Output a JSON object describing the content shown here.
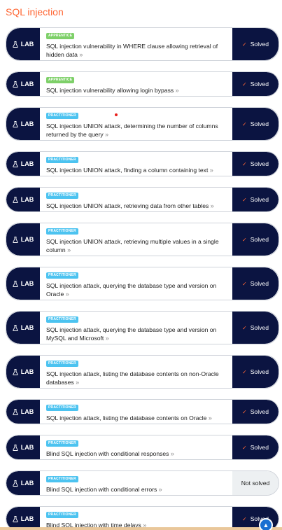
{
  "section": {
    "title": "SQL injection"
  },
  "lab_label": "LAB",
  "labs": [
    {
      "level": "APPRENTICE",
      "level_class": "apprentice",
      "name": "SQL injection vulnerability in WHERE clause allowing retrieval of hidden data",
      "status": "Solved",
      "solved": true
    },
    {
      "level": "APPRENTICE",
      "level_class": "apprentice",
      "name": "SQL injection vulnerability allowing login bypass",
      "status": "Solved",
      "solved": true
    },
    {
      "level": "PRACTITIONER",
      "level_class": "practitioner",
      "name": "SQL injection UNION attack, determining the number of columns returned by the query",
      "status": "Solved",
      "solved": true
    },
    {
      "level": "PRACTITIONER",
      "level_class": "practitioner",
      "name": "SQL injection UNION attack, finding a column containing text",
      "status": "Solved",
      "solved": true
    },
    {
      "level": "PRACTITIONER",
      "level_class": "practitioner",
      "name": "SQL injection UNION attack, retrieving data from other tables",
      "status": "Solved",
      "solved": true
    },
    {
      "level": "PRACTITIONER",
      "level_class": "practitioner",
      "name": "SQL injection UNION attack, retrieving multiple values in a single column",
      "status": "Solved",
      "solved": true
    },
    {
      "level": "PRACTITIONER",
      "level_class": "practitioner",
      "name": "SQL injection attack, querying the database type and version on Oracle",
      "status": "Solved",
      "solved": true
    },
    {
      "level": "PRACTITIONER",
      "level_class": "practitioner",
      "name": "SQL injection attack, querying the database type and version on MySQL and Microsoft",
      "status": "Solved",
      "solved": true
    },
    {
      "level": "PRACTITIONER",
      "level_class": "practitioner",
      "name": "SQL injection attack, listing the database contents on non-Oracle databases",
      "status": "Solved",
      "solved": true
    },
    {
      "level": "PRACTITIONER",
      "level_class": "practitioner",
      "name": "SQL injection attack, listing the database contents on Oracle",
      "status": "Solved",
      "solved": true
    },
    {
      "level": "PRACTITIONER",
      "level_class": "practitioner",
      "name": "Blind SQL injection with conditional responses",
      "status": "Solved",
      "solved": true
    },
    {
      "level": "PRACTITIONER",
      "level_class": "practitioner",
      "name": "Blind SQL injection with conditional errors",
      "status": "Not solved",
      "solved": false
    },
    {
      "level": "PRACTITIONER",
      "level_class": "practitioner",
      "name": "Blind SQL injection with time delays",
      "status": "Solved",
      "solved": true
    }
  ],
  "icons": {
    "lab": "flask-icon",
    "solved": "check-icon",
    "name_link": "double-chevron-right-icon",
    "scroll": "arrow-up-icon"
  },
  "colors": {
    "title": "#ff6633",
    "navy": "#0b1441",
    "apprentice": "#7ed069",
    "practitioner": "#4cc3f0",
    "not_solved_bg": "#edf0f2"
  }
}
